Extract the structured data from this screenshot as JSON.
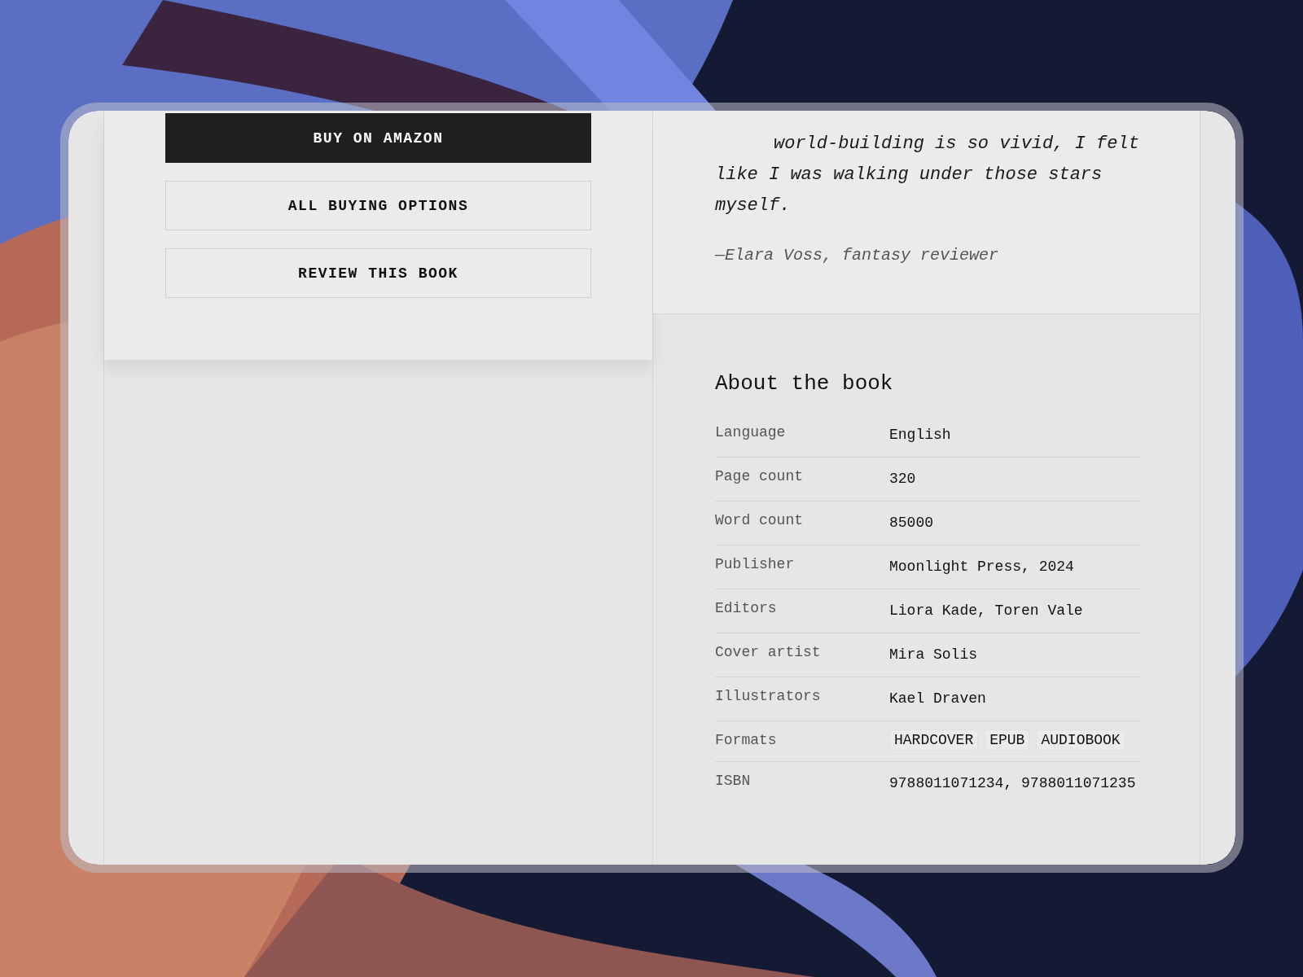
{
  "actions": [
    {
      "kind": "primary",
      "label": "BUY ON **AMAZON**"
    },
    {
      "kind": "outline",
      "label": "ALL BUYING OPTIONS"
    },
    {
      "kind": "outline",
      "label": "REVIEW THIS BOOK"
    }
  ],
  "quote": {
    "text": "world-building is so vivid, I felt like I was walking under those stars myself.",
    "attribution": "—Elara Voss, fantasy reviewer"
  },
  "about": {
    "title": "About the book",
    "rows": [
      {
        "kind": "text",
        "label": "Language",
        "value": "English"
      },
      {
        "kind": "text",
        "label": "Page count",
        "value": "320"
      },
      {
        "kind": "text",
        "label": "Word count",
        "value": "85000"
      },
      {
        "kind": "text",
        "label": "Publisher",
        "value": "Moonlight Press, 2024"
      },
      {
        "kind": "text",
        "label": "Editors",
        "value": "Liora Kade, Toren Vale"
      },
      {
        "kind": "text",
        "label": "Cover artist",
        "value": "Mira Solis"
      },
      {
        "kind": "text",
        "label": "Illustrators",
        "value": "Kael Draven"
      },
      {
        "kind": "tags",
        "label": "Formats",
        "tags": [
          "HARDCOVER",
          "EPUB",
          "AUDIOBOOK"
        ]
      },
      {
        "kind": "text",
        "label": "ISBN",
        "value": "9788011071234, 9788011071235"
      }
    ]
  }
}
